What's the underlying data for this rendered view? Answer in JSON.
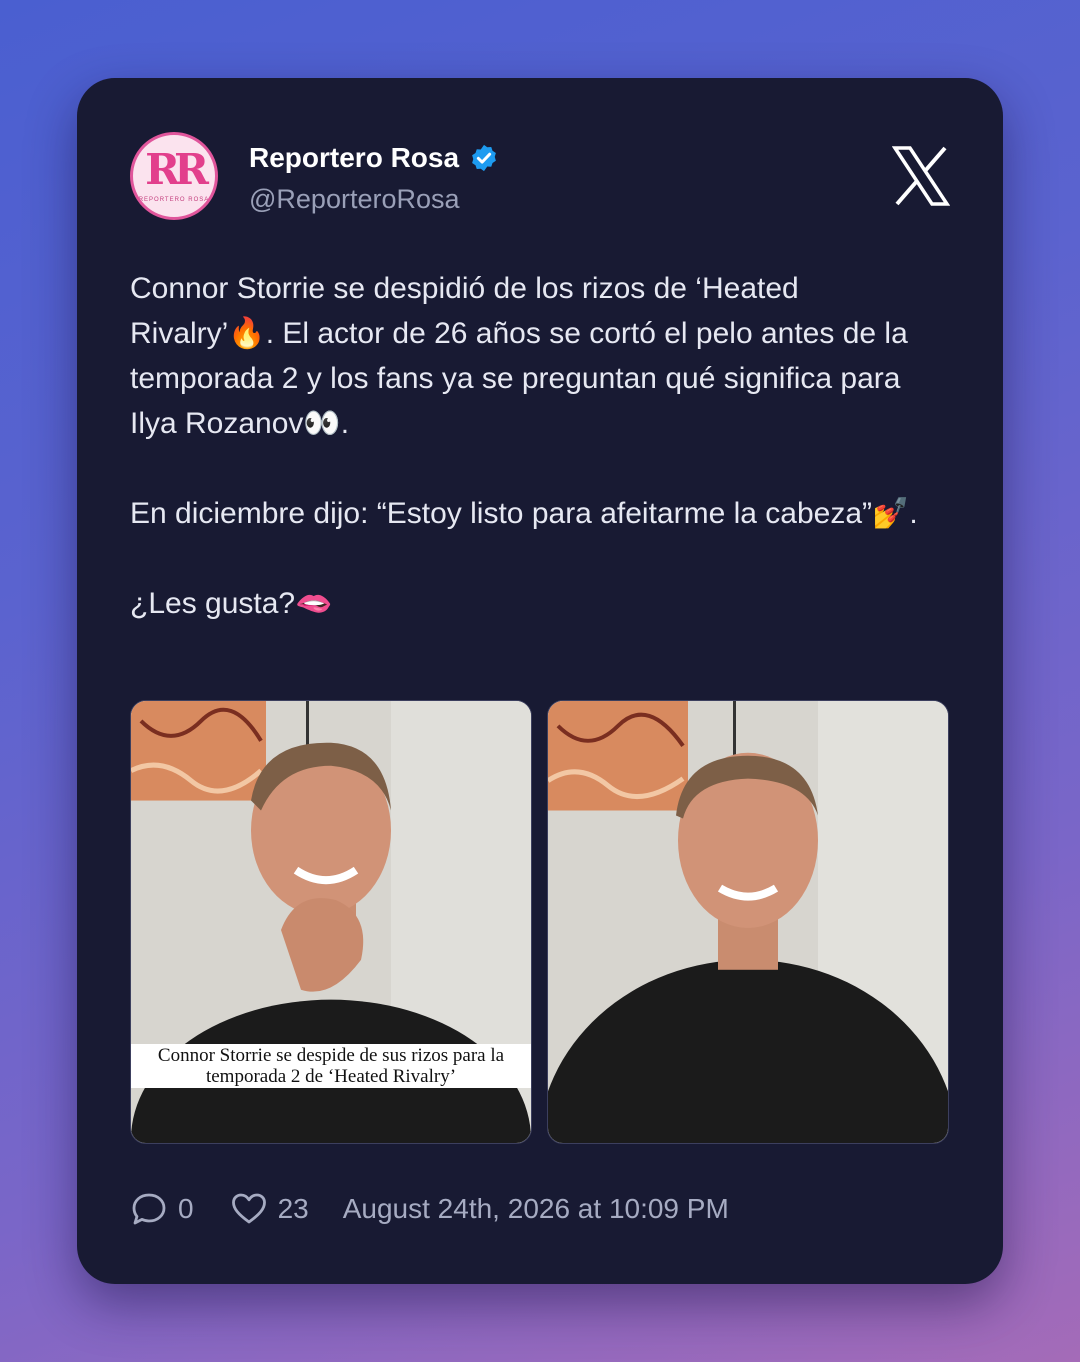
{
  "account": {
    "name": "Reportero Rosa",
    "handle": "@ReporteroRosa",
    "avatar_monogram": "RR",
    "avatar_brand": "REPORTERO ROSA",
    "verified": true
  },
  "post": {
    "paragraph1": "Connor Storrie se despidió de los rizos de ‘Heated Rivalry’🔥. El actor de 26 años se cortó el pelo antes de la temporada 2 y los fans ya se preguntan qué significa para Ilya Rozanov👀.",
    "paragraph2": "En diciembre dijo: “Estoy listo para afeitarme la cabeza”💅.",
    "paragraph3": "¿Les gusta?🫦"
  },
  "media": {
    "image1_caption": "Connor Storrie se despide de sus rizos para la temporada 2 de ‘Heated Rivalry’"
  },
  "stats": {
    "replies": "0",
    "likes": "23",
    "timestamp": "August 24th, 2026 at 10:09 PM"
  },
  "colors": {
    "card_bg": "#181a33",
    "verified_badge": "#1d9bf0",
    "brand_pink": "#e23f8c"
  },
  "icons": [
    "x-logo-icon",
    "verified-badge-icon",
    "reply-icon",
    "heart-icon"
  ]
}
